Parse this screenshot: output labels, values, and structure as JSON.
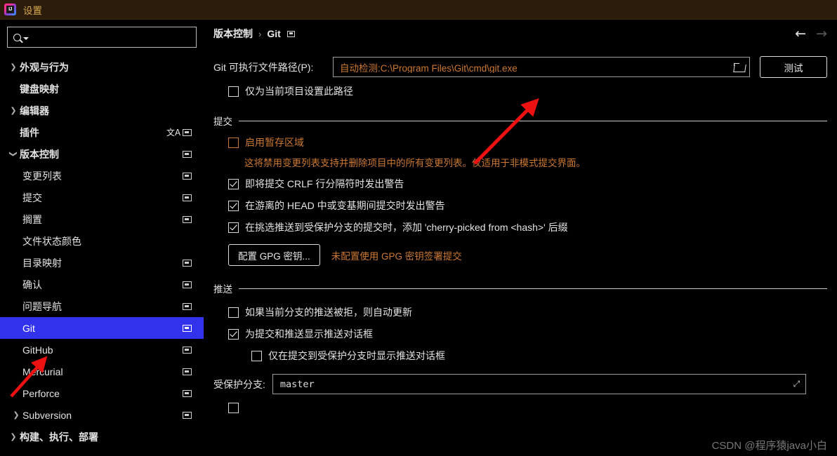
{
  "titlebar": {
    "app_icon": "intellij-idea-logo",
    "title": "设置"
  },
  "sidebar": {
    "search": {
      "placeholder": "",
      "value": "",
      "icon": "search-icon"
    },
    "items": [
      {
        "label": "外观与行为",
        "level": 0,
        "arrow": "collapsed",
        "bold": true,
        "icons": []
      },
      {
        "label": "键盘映射",
        "level": 0,
        "arrow": "none",
        "bold": true,
        "icons": []
      },
      {
        "label": "编辑器",
        "level": 0,
        "arrow": "collapsed",
        "bold": true,
        "icons": []
      },
      {
        "label": "插件",
        "level": 0,
        "arrow": "none",
        "bold": true,
        "icons": [
          "translate-icon",
          "screen-icon"
        ]
      },
      {
        "label": "版本控制",
        "level": 0,
        "arrow": "expanded",
        "bold": true,
        "icons": [
          "screen-icon"
        ]
      },
      {
        "label": "变更列表",
        "level": 1,
        "arrow": "none",
        "bold": false,
        "icons": [
          "screen-icon"
        ]
      },
      {
        "label": "提交",
        "level": 1,
        "arrow": "none",
        "bold": false,
        "icons": [
          "screen-icon"
        ]
      },
      {
        "label": "搁置",
        "level": 1,
        "arrow": "none",
        "bold": false,
        "icons": [
          "screen-icon"
        ]
      },
      {
        "label": "文件状态颜色",
        "level": 1,
        "arrow": "none",
        "bold": false,
        "icons": []
      },
      {
        "label": "目录映射",
        "level": 1,
        "arrow": "none",
        "bold": false,
        "icons": [
          "screen-icon"
        ]
      },
      {
        "label": "确认",
        "level": 1,
        "arrow": "none",
        "bold": false,
        "icons": [
          "screen-icon"
        ]
      },
      {
        "label": "问题导航",
        "level": 1,
        "arrow": "none",
        "bold": false,
        "icons": [
          "screen-icon"
        ]
      },
      {
        "label": "Git",
        "level": 1,
        "arrow": "none",
        "bold": false,
        "icons": [
          "screen-icon"
        ],
        "selected": true
      },
      {
        "label": "GitHub",
        "level": 1,
        "arrow": "none",
        "bold": false,
        "icons": [
          "screen-icon"
        ]
      },
      {
        "label": "Mercurial",
        "level": 1,
        "arrow": "none",
        "bold": false,
        "icons": [
          "screen-icon"
        ]
      },
      {
        "label": "Perforce",
        "level": 1,
        "arrow": "none",
        "bold": false,
        "icons": [
          "screen-icon"
        ]
      },
      {
        "label": "Subversion",
        "level": 1,
        "arrow": "collapsed",
        "bold": false,
        "icons": [
          "screen-icon"
        ]
      },
      {
        "label": "构建、执行、部署",
        "level": 0,
        "arrow": "collapsed",
        "bold": true,
        "icons": []
      }
    ]
  },
  "content": {
    "breadcrumb": {
      "root": "版本控制",
      "separator": "›",
      "current": "Git",
      "icon": "screen-icon"
    },
    "nav": {
      "back": "←",
      "forward": "→"
    },
    "path": {
      "label": "Git 可执行文件路径(P):",
      "value": "自动检测:C:\\Program Files\\Git\\cmd\\git.exe",
      "browse_icon": "folder-icon",
      "test_button": "测试"
    },
    "project_only_checkbox": {
      "label": "仅为当前项目设置此路径",
      "checked": false
    },
    "commit_section": {
      "title": "提交",
      "staging_checkbox": {
        "label": "启用暂存区域",
        "checked": false,
        "modified": true
      },
      "staging_description": "这将禁用变更列表支持并删除项目中的所有变更列表。仅适用于非模式提交界面。",
      "checkboxes": [
        {
          "label": "即将提交 CRLF 行分隔符时发出警告",
          "checked": true
        },
        {
          "label": "在游离的 HEAD 中或变基期间提交时发出警告",
          "checked": true
        },
        {
          "label": "在挑选推送到受保护分支的提交时，添加 'cherry-picked from <hash>' 后缀",
          "checked": true
        }
      ],
      "gpg_button": "配置 GPG 密钥...",
      "gpg_note": "未配置使用 GPG 密钥签署提交"
    },
    "push_section": {
      "title": "推送",
      "checkboxes": [
        {
          "label": "如果当前分支的推送被拒，则自动更新",
          "checked": false,
          "indent": 1
        },
        {
          "label": "为提交和推送显示推送对话框",
          "checked": true,
          "indent": 1
        },
        {
          "label": "仅在提交到受保护分支时显示推送对话框",
          "checked": false,
          "indent": 2
        }
      ],
      "protected_branch": {
        "label": "受保护分支:",
        "value": "master",
        "expand_icon": "expand-icon"
      }
    }
  },
  "watermark": "CSDN @程序猿java小白",
  "colors": {
    "selection": "#3333ee",
    "modified": "#cc7832",
    "titlebar_bg": "#2b1c0c",
    "title_text": "#d8a84e",
    "annotation": "#ee1111"
  }
}
